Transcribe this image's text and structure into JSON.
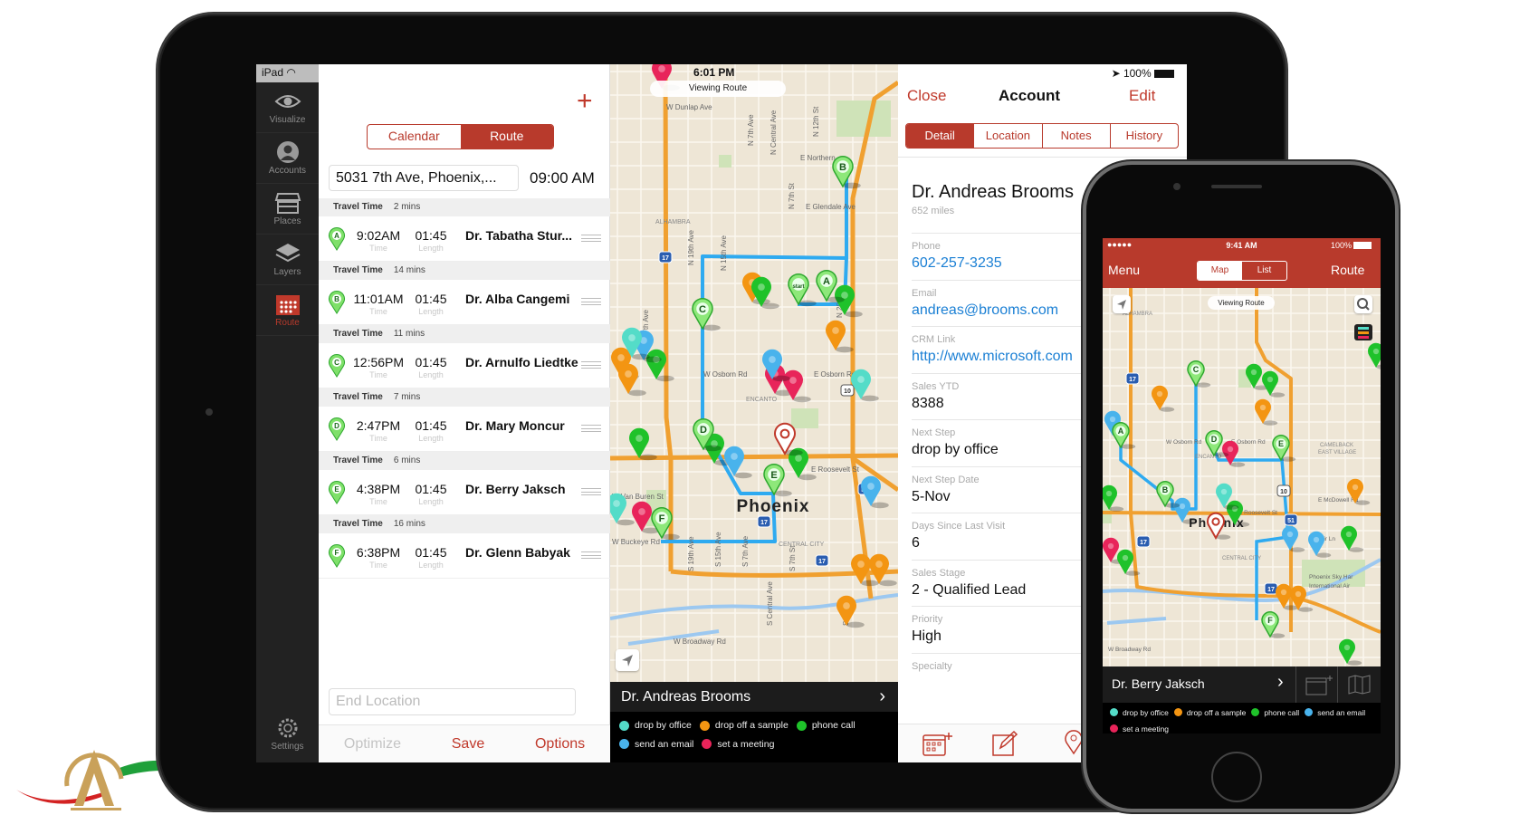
{
  "ipad": {
    "status": {
      "device": "iPad",
      "time": "6:01 PM",
      "battery": "100%"
    },
    "sidebar": {
      "items": [
        {
          "label": "Visualize",
          "icon": "eye-icon"
        },
        {
          "label": "Accounts",
          "icon": "person-icon"
        },
        {
          "label": "Places",
          "icon": "store-icon"
        },
        {
          "label": "Layers",
          "icon": "layers-icon"
        },
        {
          "label": "Route",
          "icon": "calendar-grid-icon",
          "active": true
        }
      ],
      "settings": "Settings"
    },
    "list": {
      "add_icon": "plus-icon",
      "segments": [
        "Calendar",
        "Route"
      ],
      "selected_segment": "Route",
      "start_address": "5031 7th Ave, Phoenix,...",
      "start_time": "09:00 AM",
      "travel_label": "Travel Time",
      "time_label": "Time",
      "length_label": "Length",
      "stops": [
        {
          "travel": "2 mins",
          "letter": "A",
          "time": "9:02AM",
          "length": "01:45",
          "name": "Dr. Tabatha Stur..."
        },
        {
          "travel": "14 mins",
          "letter": "B",
          "time": "11:01AM",
          "length": "01:45",
          "name": "Dr. Alba Cangemi"
        },
        {
          "travel": "11 mins",
          "letter": "C",
          "time": "12:56PM",
          "length": "01:45",
          "name": "Dr. Arnulfo Liedtke"
        },
        {
          "travel": "7 mins",
          "letter": "D",
          "time": "2:47PM",
          "length": "01:45",
          "name": "Dr. Mary Moncur"
        },
        {
          "travel": "6 mins",
          "letter": "E",
          "time": "4:38PM",
          "length": "01:45",
          "name": "Dr. Berry Jaksch"
        },
        {
          "travel": "16 mins",
          "letter": "F",
          "time": "6:38PM",
          "length": "01:45",
          "name": "Dr. Glenn Babyak"
        }
      ],
      "end_location_placeholder": "End Location",
      "actions": {
        "optimize": "Optimize",
        "save": "Save",
        "options": "Options"
      }
    },
    "map": {
      "banner": "Viewing Route",
      "start_pin": "start",
      "city": "Phoenix",
      "streets": [
        "W Dunlap Ave",
        "E Northern",
        "E Glendale Ave",
        "ALHAMBRA",
        "W Osborn Rd",
        "E Osborn Rd",
        "ENCANTO",
        "E Roosevelt St",
        "W Van Buren St",
        "W Buckeye Rd",
        "CENTRAL CITY",
        "W Broadway Rd",
        "N 19th Ave",
        "N 15th Ave",
        "N 7th Ave",
        "N Central Ave",
        "N 7th St",
        "N 12th St",
        "N 20th St",
        "N 27th Ave",
        "S 19th Ave",
        "S 15th Ave",
        "S 7th Ave",
        "S Central Ave",
        "S 7th St",
        "S 16th St"
      ],
      "highway_shields": [
        "17",
        "17",
        "17",
        "51",
        "10"
      ],
      "selected_account": "Dr. Andreas Brooms",
      "legend": [
        {
          "label": "drop by office",
          "color": "#54dcc8"
        },
        {
          "label": "drop off a sample",
          "color": "#f39512"
        },
        {
          "label": "phone call",
          "color": "#1fc22a"
        },
        {
          "label": "send an email",
          "color": "#49b3ec"
        },
        {
          "label": "set a meeting",
          "color": "#e8245a"
        }
      ]
    },
    "account": {
      "close": "Close",
      "title": "Account",
      "edit": "Edit",
      "tabs": [
        "Detail",
        "Location",
        "Notes",
        "History"
      ],
      "selected_tab": "Detail",
      "name": "Dr. Andreas Brooms",
      "distance": "652 miles",
      "fields": [
        {
          "label": "Phone",
          "value": "602-257-3235",
          "link": true
        },
        {
          "label": "Email",
          "value": "andreas@brooms.com",
          "link": true
        },
        {
          "label": "CRM Link",
          "value": "http://www.microsoft.com",
          "link": true
        },
        {
          "label": "Sales YTD",
          "value": "8388"
        },
        {
          "label": "Next Step",
          "value": "drop by office"
        },
        {
          "label": "Next Step Date",
          "value": "5-Nov"
        },
        {
          "label": "Days Since Last Visit",
          "value": "6"
        },
        {
          "label": "Sales Stage",
          "value": "2 - Qualified Lead"
        },
        {
          "label": "Priority",
          "value": "High"
        },
        {
          "label": "Specialty",
          "value": ""
        }
      ],
      "toolbar_icons": [
        "calendar-add-icon",
        "edit-icon",
        "map-pin-icon"
      ]
    }
  },
  "iphone": {
    "status": {
      "signal": "●●●●●",
      "time": "9:41 AM",
      "battery": "100%"
    },
    "nav": {
      "menu": "Menu",
      "segments": [
        "Map",
        "List"
      ],
      "selected_segment": "Map",
      "route": "Route"
    },
    "map": {
      "banner": "Viewing Route",
      "city": "Phoenix",
      "streets": [
        "ALHAMBRA",
        "W Osborn Rd",
        "E Osborn Rd",
        "ENCANTO",
        "E Roosevelt St",
        "CENTRAL CITY",
        "CAMELBACK",
        "EAST VILLAGE",
        "E McDowell Rd",
        "Air Ln",
        "Phoenix Sky Har",
        "International Air",
        "W Broadway Rd"
      ],
      "highway_shields": [
        "17",
        "17",
        "17",
        "51",
        "10"
      ]
    },
    "selected_account": "Dr. Berry Jaksch",
    "legend": [
      {
        "label": "drop by office",
        "color": "#54dcc8"
      },
      {
        "label": "drop off a sample",
        "color": "#f39512"
      },
      {
        "label": "phone call",
        "color": "#1fc22a"
      },
      {
        "label": "send an email",
        "color": "#49b3ec"
      },
      {
        "label": "set a meeting",
        "color": "#e8245a"
      }
    ]
  },
  "colors": {
    "brand_red": "#b83a2c",
    "route_blue": "#2eaaf0",
    "highway_orange": "#f0a030",
    "map_bg": "#eee6d6"
  }
}
